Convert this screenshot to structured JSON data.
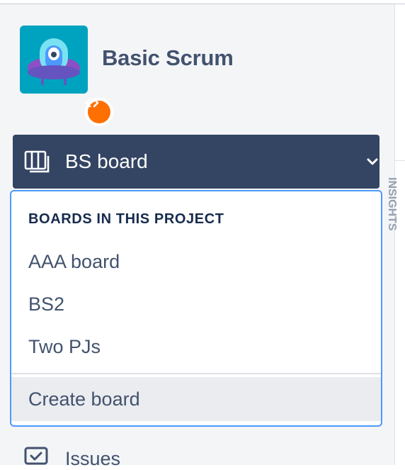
{
  "project": {
    "name": "Basic Scrum",
    "avatar_icon": "ufo-robot-icon",
    "badge_icon": "code-brackets-icon"
  },
  "board_selector": {
    "label": "BS board",
    "icon": "board-columns-icon",
    "chevron": "chevron-down-icon"
  },
  "dropdown": {
    "heading": "BOARDS IN THIS PROJECT",
    "items": [
      {
        "label": "AAA board"
      },
      {
        "label": "BS2"
      },
      {
        "label": "Two PJs"
      }
    ],
    "create_label": "Create board"
  },
  "nav": {
    "issues_label": "Issues",
    "issues_icon": "issues-checkbox-icon"
  },
  "right_panel": {
    "vertical_text": "INSIGHTS"
  },
  "colors": {
    "selector_bg": "#344563",
    "focus_border": "#4c9aff",
    "badge_orange": "#ff7002",
    "avatar_teal": "#00a3bf",
    "sidebar_bg": "#f4f5f7",
    "hover_bg": "#ebecf0"
  }
}
